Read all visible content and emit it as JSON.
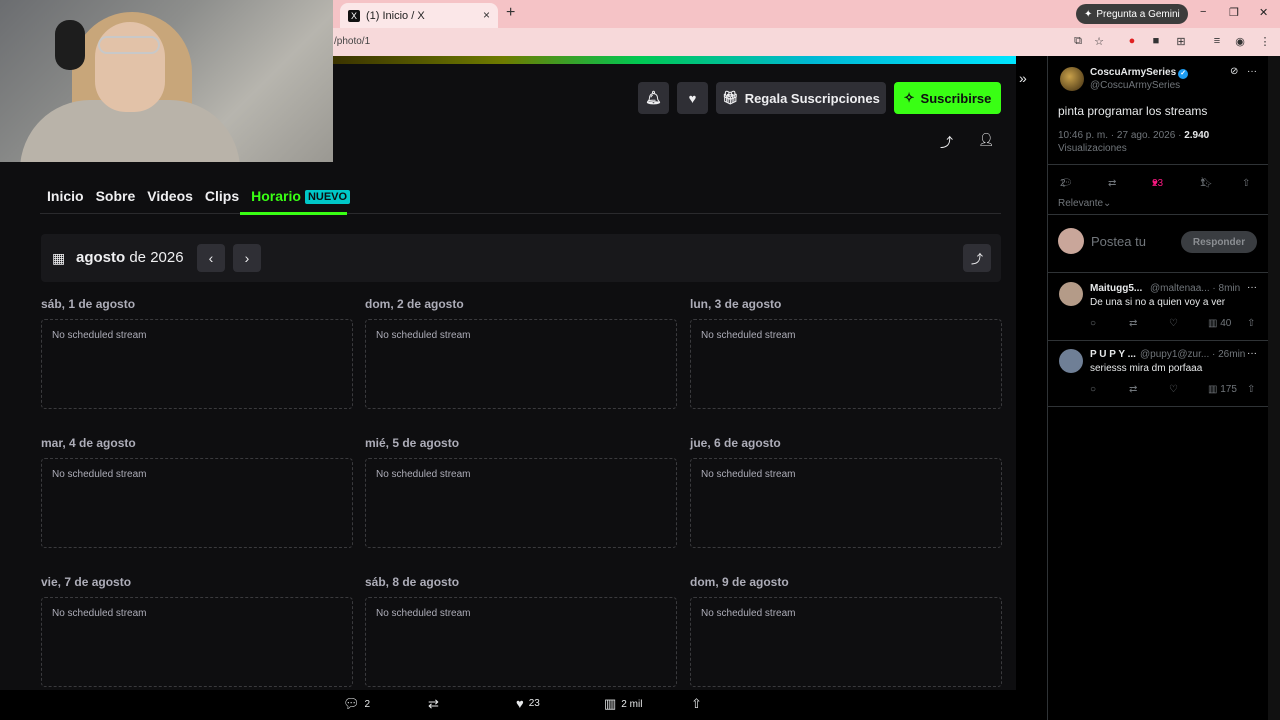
{
  "browser": {
    "tab_title": "(1) Inicio / X",
    "tab_close": "×",
    "new_tab": "+",
    "gemini_label": "Pregunta a Gemini",
    "url": "/photo/1",
    "win_min": "−",
    "win_max": "❐",
    "win_close": "✕"
  },
  "twitch": {
    "gift_label": "Regala Suscripciones",
    "subscribe_label": "Suscribirse",
    "nav": {
      "inicio": "Inicio",
      "sobre": "Sobre",
      "videos": "Videos",
      "clips": "Clips",
      "horario": "Horario",
      "nuevo_badge": "NUEVO"
    },
    "calendar": {
      "month_bold": "agosto",
      "month_rest": " de 2026",
      "empty_text": "No scheduled stream",
      "days": [
        "sáb, 1 de agosto",
        "dom, 2 de agosto",
        "lun, 3 de agosto",
        "mar, 4 de agosto",
        "mié, 5 de agosto",
        "jue, 6 de agosto",
        "vie, 7 de agosto",
        "sáb, 8 de agosto",
        "dom, 9 de agosto"
      ]
    }
  },
  "post_bar": {
    "replies": "2",
    "likes": "23",
    "views": "2 mil"
  },
  "x_post": {
    "name": "CoscuArmySeries",
    "handle": "@CoscuArmySeries",
    "text": "pinta programar los streams",
    "timestamp": "10:46 p. m. · 27 ago. 2026 ·",
    "views_count": "2.940",
    "views_label": "Visualizaciones",
    "replies": "2",
    "likes": "23",
    "bookmarks": "1",
    "relevance": "Relevante",
    "reply_placeholder": "Postea tu",
    "reply_button": "Responder",
    "accent_like": "#f91880",
    "accent_verified": "#1d9bf0"
  },
  "comments": [
    {
      "name": "Maitugg5...",
      "handle": "@maltenaa... · 8min",
      "text": "De una si no a quien voy a ver",
      "views": "40"
    },
    {
      "name": "P U P Y ...",
      "handle": "@pupy1@zur... · 26min",
      "text": "seriesss mira dm porfaaa",
      "views": "175"
    }
  ]
}
